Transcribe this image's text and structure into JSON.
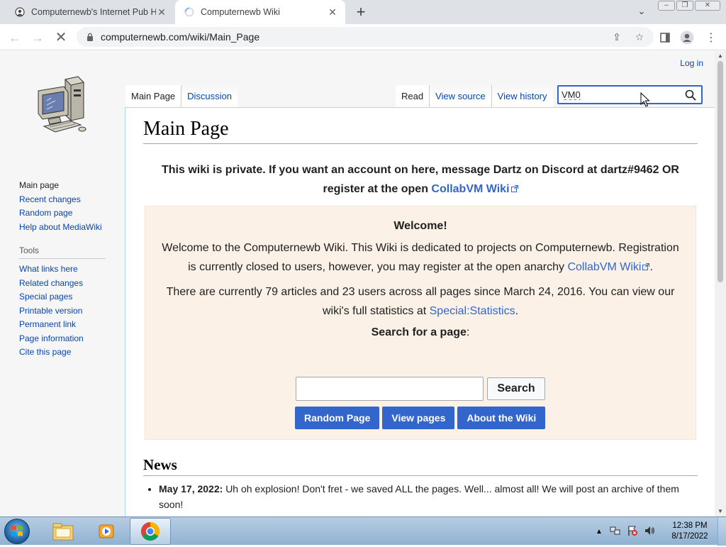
{
  "browser": {
    "tabs": [
      {
        "title": "Computernewb's Internet Pub Hu",
        "active": false
      },
      {
        "title": "Computernewb Wiki",
        "active": true
      }
    ],
    "url": "computernewb.com/wiki/Main_Page"
  },
  "wiki": {
    "personal": {
      "login": "Log in"
    },
    "page_tabs": {
      "main_page": "Main Page",
      "discussion": "Discussion",
      "read": "Read",
      "view_source": "View source",
      "view_history": "View history"
    },
    "search": {
      "value": "VM0"
    },
    "sidebar": {
      "nav": [
        "Main page",
        "Recent changes",
        "Random page",
        "Help about MediaWiki"
      ],
      "tools_heading": "Tools",
      "tools": [
        "What links here",
        "Related changes",
        "Special pages",
        "Printable version",
        "Permanent link",
        "Page information",
        "Cite this page"
      ]
    },
    "heading": "Main Page",
    "notice": {
      "text": "This wiki is private. If you want an account on here, message Dartz on Discord at dartz#9462 OR register at the open",
      "link": "CollabVM Wiki"
    },
    "welcome": {
      "title": "Welcome!",
      "p1_text": "Welcome to the Computernewb Wiki. This Wiki is dedicated to projects on Computernewb. Registration is currently closed to users, however, you may register at the open anarchy",
      "p1_link": "CollabVM Wiki",
      "p2_text": "There are currently 79 articles and 23 users across all pages since March 24, 2016. You can view our wiki's full statistics at",
      "p2_link": "Special:Statistics",
      "search_label": "Search for a page",
      "search_button": "Search",
      "buttons": [
        "Random Page",
        "View pages",
        "About the Wiki"
      ]
    },
    "news": {
      "heading": "News",
      "items": [
        {
          "date": "May 17, 2022:",
          "text": "Uh oh explosion! Don't fret - we saved ALL the pages. Well... almost all! We will post an archive of them soon!"
        }
      ]
    }
  },
  "taskbar": {
    "time": "12:38 PM",
    "date": "8/17/2022"
  }
}
